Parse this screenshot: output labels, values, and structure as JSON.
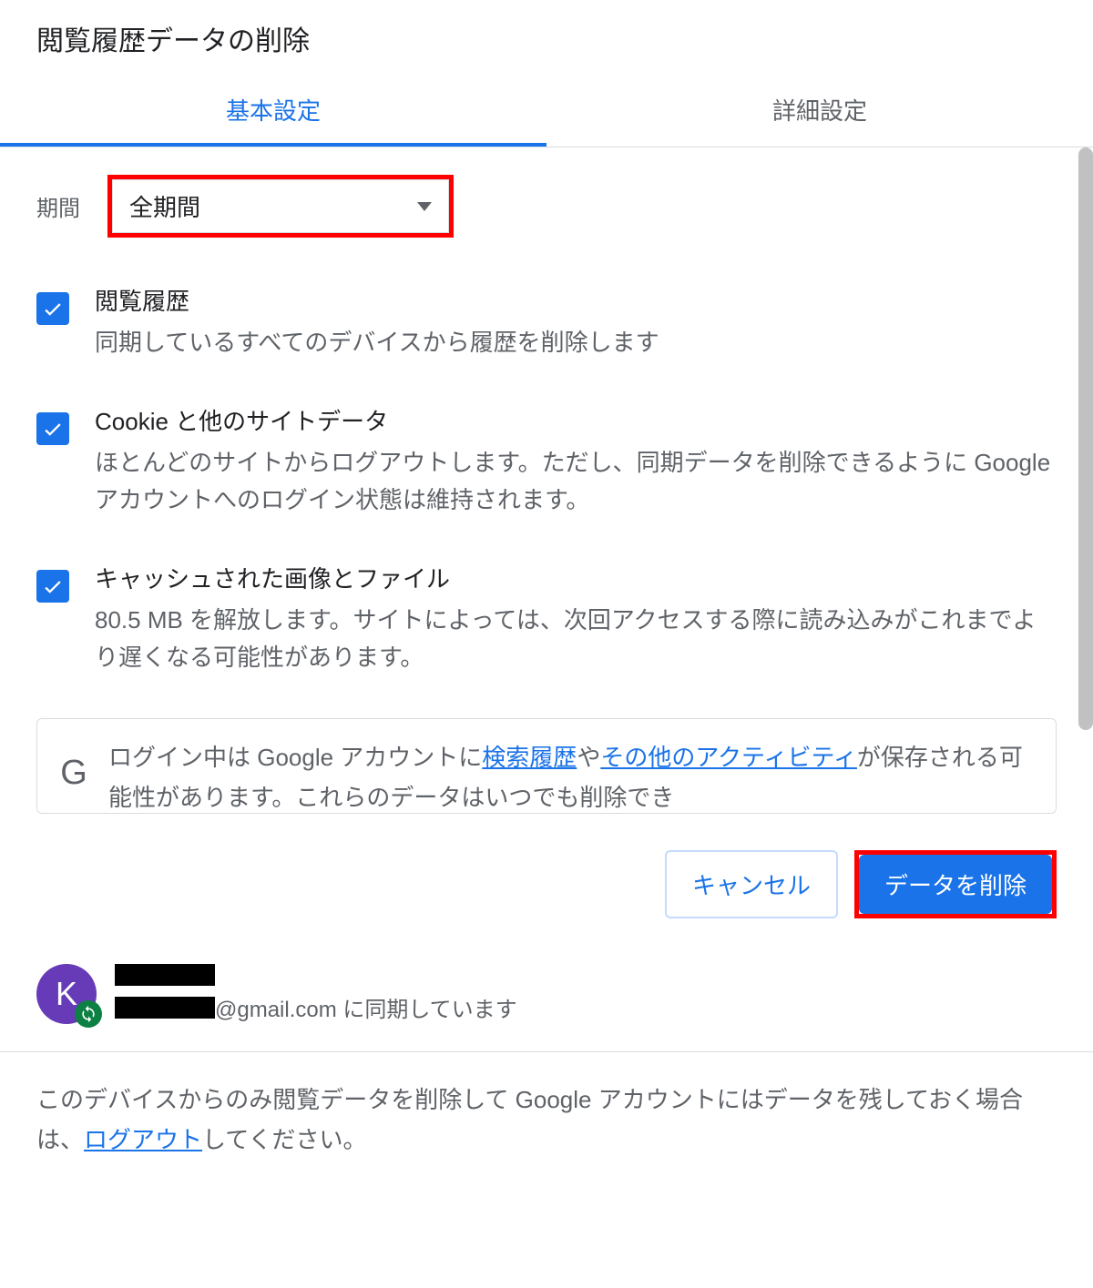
{
  "dialog": {
    "title": "閲覧履歴データの削除"
  },
  "tabs": {
    "basic": "基本設定",
    "advanced": "詳細設定"
  },
  "period": {
    "label": "期間",
    "selected": "全期間"
  },
  "items": [
    {
      "title": "閲覧履歴",
      "desc": "同期しているすべてのデバイスから履歴を削除します"
    },
    {
      "title": "Cookie と他のサイトデータ",
      "desc": "ほとんどのサイトからログアウトします。ただし、同期データを削除できるように Google アカウントへのログイン状態は維持されます。"
    },
    {
      "title": "キャッシュされた画像とファイル",
      "desc": "80.5 MB を解放します。サイトによっては、次回アクセスする際に読み込みがこれまでより遅くなる可能性があります。"
    }
  ],
  "info": {
    "text_before_link1": "ログイン中は Google アカウントに",
    "link1": "検索履歴",
    "between": "や",
    "link2": "その他のアクティビティ",
    "text_after": "が保存される可能性があります。これらのデータはいつでも削除でき"
  },
  "buttons": {
    "cancel": "キャンセル",
    "delete": "データを削除"
  },
  "account": {
    "avatar_letter": "K",
    "email_suffix": "@gmail.com に同期しています"
  },
  "footer": {
    "text_before": "このデバイスからのみ閲覧データを削除して Google アカウントにはデータを残しておく場合は、",
    "logout_link": "ログアウト",
    "text_after": "してください。"
  }
}
